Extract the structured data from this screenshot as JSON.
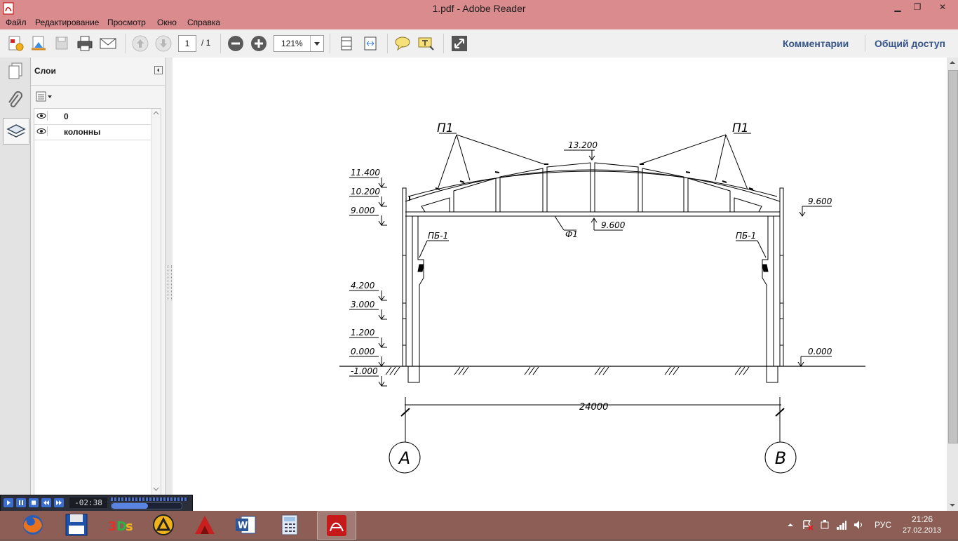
{
  "window": {
    "title": "1.pdf - Adobe Reader",
    "minimize": "▁",
    "restore": "❐",
    "close": "✕"
  },
  "menu": [
    "Файл",
    "Редактирование",
    "Просмотр",
    "Окно",
    "Справка"
  ],
  "toolbar": {
    "page_current": "1",
    "page_total": "/ 1",
    "zoom": "121%",
    "comments": "Комментарии",
    "share": "Общий доступ"
  },
  "layers_panel": {
    "title": "Слои",
    "layers": [
      "0",
      "колонны"
    ]
  },
  "drawing": {
    "purlin_label": "П1",
    "ridge_level": "13.200",
    "chord_label": "Ф1",
    "bottom_chord_level": "9.600",
    "crane_beam_label": "ПБ-1",
    "left_levels": [
      "11.400",
      "10.200",
      "9.000",
      "4.200",
      "3.000",
      "1.200",
      "0.000",
      "-1.000"
    ],
    "right_levels": [
      "9.600",
      "0.000"
    ],
    "span": "24000",
    "axis_left": "А",
    "axis_right": "В"
  },
  "media_player": {
    "time": "-02:38"
  },
  "tray": {
    "language": "РУС",
    "time": "21:26",
    "date": "27.02.2013"
  }
}
